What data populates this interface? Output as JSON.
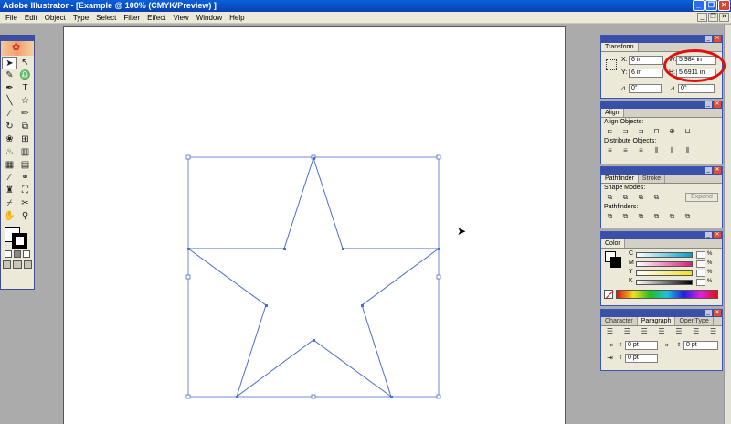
{
  "window": {
    "title": "Adobe Illustrator - [Example @ 100% (CMYK/Preview) ]"
  },
  "menu": [
    "File",
    "Edit",
    "Object",
    "Type",
    "Select",
    "Filter",
    "Effect",
    "View",
    "Window",
    "Help"
  ],
  "transform": {
    "tab": "Transform",
    "x_label": "X:",
    "x_value": "6 in",
    "y_label": "Y:",
    "y_value": "6 in",
    "w_label": "W:",
    "w_value": "5.984 in",
    "h_label": "H:",
    "h_value": "5.6911 in",
    "rotate_value": "0°",
    "shear_value": "0°"
  },
  "align": {
    "tab": "Align",
    "align_objects_label": "Align Objects:",
    "distribute_objects_label": "Distribute Objects:"
  },
  "pathfinder": {
    "tab": "Pathfinder",
    "stroke_tab": "Stroke",
    "shape_modes_label": "Shape Modes:",
    "expand_label": "Expand",
    "pathfinders_label": "Pathfinders:"
  },
  "color": {
    "tab": "Color",
    "c_label": "C",
    "m_label": "M",
    "y_label": "Y",
    "k_label": "K",
    "pct": "%"
  },
  "character": {
    "character_tab": "Character",
    "paragraph_tab": "Paragraph",
    "opentype_tab": "OpenType",
    "indent_left": "0 pt",
    "indent_right": "0 pt",
    "first_line": "0 pt"
  },
  "colors": {
    "selection": "#4a6fc8",
    "panel_head": "#3a4fa8",
    "highlight": "#e01010"
  }
}
